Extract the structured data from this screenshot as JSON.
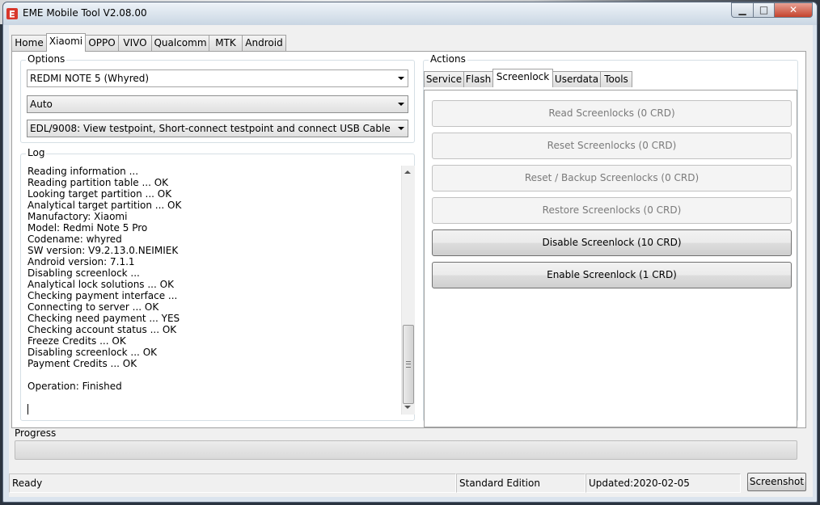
{
  "window": {
    "title": "EME Mobile Tool V2.08.00",
    "controls": {
      "minimize": "▁",
      "maximize": "□",
      "close": "✕"
    }
  },
  "main_tabs": [
    "Home",
    "Xiaomi",
    "OPPO",
    "VIVO",
    "Qualcomm",
    "MTK",
    "Android"
  ],
  "active_main_tab": "Xiaomi",
  "options": {
    "label": "Options",
    "model": "REDMI NOTE 5 (Whyred)",
    "mode": "Auto",
    "connection": "EDL/9008: View testpoint, Short-connect testpoint and connect USB Cable"
  },
  "log": {
    "label": "Log",
    "lines": [
      "Reading information ...",
      "Reading partition table ... OK",
      "Looking target partition ... OK",
      "Analytical target partition ... OK",
      "Manufactory: Xiaomi",
      "Model: Redmi Note 5 Pro",
      "Codename: whyred",
      "SW version: V9.2.13.0.NEIMIEK",
      "Android version: 7.1.1",
      "Disabling screenlock ...",
      "Analytical lock solutions ... OK",
      "Checking payment interface ...",
      "Connecting to server ... OK",
      "Checking need payment ... YES",
      "Checking account status ... OK",
      "Freeze Credits ... OK",
      "Disabling screenlock ... OK",
      "Payment Credits ... OK",
      "",
      "Operation: Finished"
    ]
  },
  "actions": {
    "label": "Actions",
    "tabs": [
      "Service",
      "Flash",
      "Screenlock",
      "Userdata",
      "Tools"
    ],
    "active_tab": "Screenlock",
    "buttons": [
      {
        "label": "Read Screenlocks (0 CRD)",
        "enabled": false
      },
      {
        "label": "Reset Screenlocks (0 CRD)",
        "enabled": false
      },
      {
        "label": "Reset / Backup Screenlocks (0 CRD)",
        "enabled": false
      },
      {
        "label": "Restore Screenlocks (0 CRD)",
        "enabled": false
      },
      {
        "label": "Disable Screenlock (10 CRD)",
        "enabled": true
      },
      {
        "label": "Enable Screenlock (1 CRD)",
        "enabled": true
      }
    ]
  },
  "progress": {
    "label": "Progress",
    "fraction": 0.0
  },
  "status_bar": {
    "status": "Ready",
    "edition": "Standard Edition",
    "updated": "Updated:2020-02-05",
    "screenshot_button": "Screenshot"
  },
  "colors": {
    "progress_green": "#06b025",
    "icon_red": "#d8372b",
    "disabled_text": "#7a7a7a"
  }
}
